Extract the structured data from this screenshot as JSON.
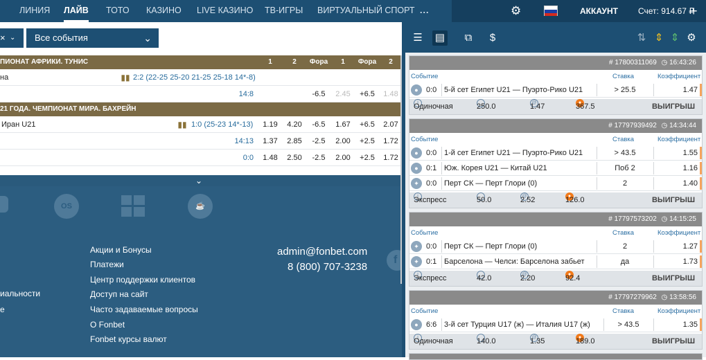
{
  "nav": {
    "items": [
      "ЛИНИЯ",
      "ЛАЙВ",
      "ТОТО",
      "КАЗИНО",
      "LIVE КАЗИНО",
      "ТВ-ИГРЫ",
      "ВИРТУАЛЬНЫЙ СПОРТ",
      "..."
    ],
    "account": "АККАУНТ",
    "balance": "Счет: 914.67 ₽"
  },
  "filter": {
    "left_close": "×",
    "events_select": "Все события"
  },
  "table": {
    "cols": [
      "1",
      "2",
      "Фора",
      "1",
      "Фора",
      "2"
    ],
    "league1": "ЕМПИОНАТ АФРИКИ. ТУНИС",
    "league1_partial": "ПИОНАТ АФРИКИ. ТУНИС",
    "l1_rows": [
      {
        "name": "на",
        "score": "2:2 (22-25 25-20 21-25 25-18 14*-8)",
        "o1": "",
        "o2": "",
        "f1": "",
        "oa": "",
        "f2": "",
        "ob": ""
      },
      {
        "name": "",
        "score": "14:8",
        "o1": "",
        "o2": "",
        "f1": "-6.5",
        "oa": "2.45",
        "f2": "+6.5",
        "ob": "1.48"
      }
    ],
    "league2": "21 ГОДА. ЧЕМПИОНАТ МИРА. БАХРЕЙН",
    "l2_rows": [
      {
        "name": "Иран U21",
        "score": "1:0 (25-23 14*-13)",
        "o1": "1.19",
        "o2": "4.20",
        "f1": "-6.5",
        "oa": "1.67",
        "f2": "+6.5",
        "ob": "2.07"
      },
      {
        "name": "",
        "score": "14:13",
        "o1": "1.37",
        "o2": "2.85",
        "f1": "-2.5",
        "oa": "2.00",
        "f2": "+2.5",
        "ob": "1.72"
      },
      {
        "name": "",
        "score": "0:0",
        "o1": "1.48",
        "o2": "2.50",
        "f1": "-2.5",
        "oa": "2.00",
        "f2": "+2.5",
        "ob": "1.72"
      }
    ]
  },
  "footer": {
    "os": [
      "MAC OS"
    ],
    "links_mid": [
      "Акции и Бонусы",
      "Платежи",
      "Центр поддержки клиентов",
      "Доступ на сайт",
      "Часто задаваемые вопросы",
      "О Fonbet",
      "Fonbet курсы валют"
    ],
    "links_left": [
      "иальности",
      "е"
    ],
    "email": "admin@fonbet.com",
    "phone": "8 (800) 707-3238"
  },
  "bets": {
    "col_event": "Событие",
    "col_stake": "Ставка",
    "col_coef": "Коэффициент",
    "cards": [
      {
        "id": "# 17800311069",
        "time": "16:43:26",
        "rows": [
          {
            "score": "0:0",
            "event": "5-й сет Египет U21 — Пуэрто-Рико U21",
            "stake": "> 25.5",
            "coef": "1.47"
          }
        ],
        "type": "Одиночная",
        "sum": "250.0",
        "k": "1.47",
        "win_sum": "367.5",
        "result": "ВЫИГРЫШ"
      },
      {
        "id": "# 17797939492",
        "time": "14:34:44",
        "rows": [
          {
            "score": "0:0",
            "event": "1-й сет Египет U21 — Пуэрто-Рико U21",
            "stake": "> 43.5",
            "coef": "1.55"
          },
          {
            "score": "0:1",
            "event": "Юж. Корея U21 — Китай U21",
            "stake": "Поб 2",
            "coef": "1.16"
          },
          {
            "score": "0:0",
            "event": "Перт СК — Перт Глори (0)",
            "stake": "2",
            "coef": "1.40"
          }
        ],
        "type": "Экспресс",
        "sum": "50.0",
        "k": "2.52",
        "win_sum": "126.0",
        "result": "ВЫИГРЫШ"
      },
      {
        "id": "# 17797573202",
        "time": "14:15:25",
        "rows": [
          {
            "score": "0:0",
            "event": "Перт СК — Перт Глори (0)",
            "stake": "2",
            "coef": "1.27"
          },
          {
            "score": "0:1",
            "event": "Барселона — Челси: Барселона забьет",
            "stake": "да",
            "coef": "1.73"
          }
        ],
        "type": "Экспресс",
        "sum": "42.0",
        "k": "2.20",
        "win_sum": "92.4",
        "result": "ВЫИГРЫШ"
      },
      {
        "id": "# 17797279962",
        "time": "13:58:56",
        "rows": [
          {
            "score": "6:6",
            "event": "3-й сет Турция U17 (ж) — Италия U17 (ж)",
            "stake": "> 43.5",
            "coef": "1.35"
          }
        ],
        "type": "Одиночная",
        "sum": "140.0",
        "k": "1.35",
        "win_sum": "189.0",
        "result": "ВЫИГРЫШ"
      }
    ]
  },
  "colors": {
    "nav": "#1d4f73",
    "league": "#7b6a45",
    "footer": "#2c5d80",
    "orange": "#f27a1a"
  }
}
